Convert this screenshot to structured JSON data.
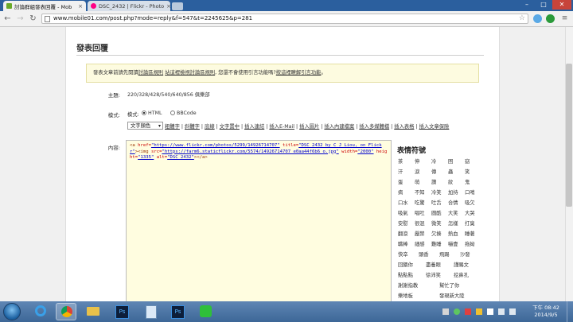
{
  "browser": {
    "tabs": [
      {
        "label": "討論群組發表回覆 - Mob",
        "active": true,
        "favicon_color": "#6aaa2a"
      },
      {
        "label": "DSC_2432 | Flickr - Photo",
        "active": false,
        "favicon_color": "#ff0084"
      }
    ],
    "url": "www.mobile01.com/post.php?mode=reply&f=547&t=2245625&p=281",
    "window_controls": [
      "–",
      "□",
      "✕"
    ]
  },
  "page": {
    "title": "發表回覆",
    "notice": {
      "prefix": "發表文章前請先閱讀",
      "link1": "討論區規則",
      "mid1": "  ",
      "link2": "站這裡檢視討論區規則",
      "mid2": ", 您還不會使用引言功能嗎?",
      "link3": "按這裡瞭解引言功能",
      "suffix": "。"
    },
    "subject": {
      "label": "主題:",
      "value": "220/328/428/540/640/856 俱樂部"
    },
    "mode": {
      "label": "模式:",
      "options": [
        {
          "label": "HTML",
          "selected": true
        },
        {
          "label": "BBCode",
          "selected": false
        }
      ]
    },
    "format_select": "文字顏色",
    "toolbar_links": [
      "粗體字",
      "斜體字",
      "底線",
      "文字置中",
      "插入連結",
      "插入E-Mail",
      "插入圖片",
      "插入內建檔案",
      "插入多媒體檔",
      "插入表格",
      "插入文章保險"
    ],
    "content_label": "內容:",
    "editor": {
      "t1": "<a ",
      "a1": "href=",
      "s1": "\"https://www.flickr.com/photos/5299/14926714707\"",
      "a2": " title=",
      "s2": "\"DSC_2432 by C J Liou, on Flickr\"",
      "t2": "><img ",
      "a3": "src=",
      "s3": "\"https://farm6.staticflickr.com/5574/14926714707_e0aa44f6b6_o.jpg\"",
      "a4": " width=",
      "s4": "\"2000\"",
      "a5": " height=",
      "s5": "\"1335\"",
      "a6": " alt=",
      "s6": "\"DSC_2432\"",
      "t3": "></a>"
    },
    "emoticons": {
      "title": "表情符號",
      "items": [
        "茶",
        "伸",
        "冷",
        "困",
        "窈",
        "汗",
        "淚",
        "傳",
        "蟲",
        "笑",
        "蛋",
        "萌",
        "讚",
        "紋",
        "鬼",
        "病",
        "不知",
        "冷笑",
        "加持",
        "口哨",
        "口水",
        "吃驚",
        "吐舌",
        "合情",
        "吸欠",
        "吸氣",
        "唱吐",
        "圓酷",
        "大笑",
        "大哭",
        "安慰",
        "很混",
        "微笑",
        "怎樣",
        "打臭",
        "翻滾",
        "嚴禁",
        "欠揍",
        "熱血",
        "睡著",
        "職棒",
        "細感",
        "難睡",
        "嚇壹",
        "拖拗",
        "快卒",
        "頭香",
        "飛踢",
        "沙發",
        "回餵你",
        "盡養眼",
        "謹賜文",
        "點點點",
        "徐沛笑",
        "挖鼻孔",
        "謝謝指教",
        "幫忙了你",
        "樂地板",
        "發現新大陸"
      ]
    }
  },
  "taskbar": {
    "apps": [
      "ie",
      "chrome",
      "explorer",
      "photoshop",
      "notepad",
      "photoshop2",
      "line"
    ],
    "clock_time": "下午 08:42",
    "clock_date": "2014/9/5"
  }
}
